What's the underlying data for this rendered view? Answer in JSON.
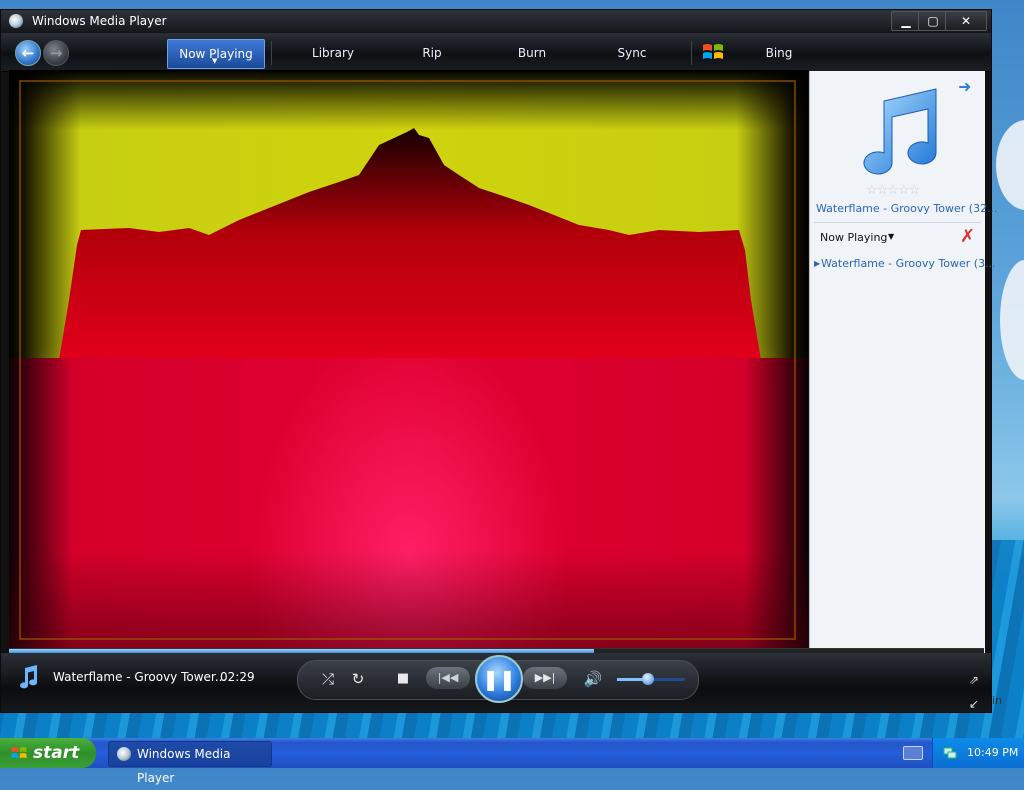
{
  "window": {
    "title": "Windows Media Player",
    "minimize_label": "▁",
    "maximize_label": "▢",
    "close_label": "✕"
  },
  "toolbar": {
    "back_icon": "back-arrow-icon",
    "forward_icon": "forward-arrow-icon",
    "tabs": [
      {
        "label": "Now Playing",
        "active": true
      },
      {
        "label": "Library"
      },
      {
        "label": "Rip"
      },
      {
        "label": "Burn"
      },
      {
        "label": "Sync"
      },
      {
        "label": "Bing"
      }
    ]
  },
  "side_panel": {
    "album_title": "Waterflame - Groovy Tower (32...",
    "rating_stars": "☆☆☆☆☆",
    "now_playing_label": "Now Playing",
    "playlist": [
      {
        "title": "Waterflame - Groovy Tower (3..."
      }
    ]
  },
  "playback": {
    "track": "Waterflame - Groovy Tower...",
    "time": "02:29",
    "seek_fraction": 0.6,
    "volume_fraction": 0.46
  },
  "taskbar": {
    "start_label": "start",
    "task_item": "Windows Media Player",
    "clock": "10:49 PM"
  },
  "desktop": {
    "edge_text": "in"
  },
  "colors": {
    "accent": "#2f7fd8",
    "visualizer_top": "#d0d30d",
    "visualizer_bottom": "#e10030",
    "taskbar": "#245edb",
    "start_green": "#3a9e36"
  }
}
